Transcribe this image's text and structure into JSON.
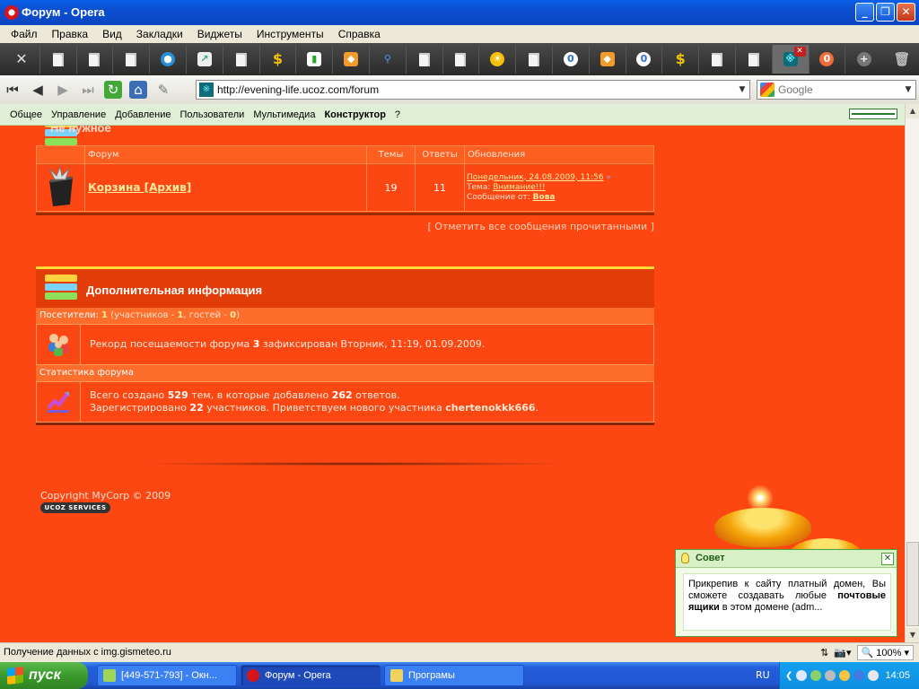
{
  "window": {
    "title": "Форум - Opera"
  },
  "menu": [
    "Файл",
    "Правка",
    "Вид",
    "Закладки",
    "Виджеты",
    "Инструменты",
    "Справка"
  ],
  "address": {
    "url": "http://evening-life.ucoz.com/forum"
  },
  "search": {
    "placeholder": "Google"
  },
  "admin_bar": [
    "Общее",
    "Управление",
    "Добавление",
    "Пользователи",
    "Мультимедиа",
    "Конструктор",
    "?"
  ],
  "forum": {
    "category_title": "Не нужное",
    "headers": {
      "forum": "Форум",
      "topics": "Темы",
      "replies": "Ответы",
      "updates": "Обновления"
    },
    "row": {
      "name": "Корзина [Архив]",
      "topics": "19",
      "replies": "11",
      "last_date": "Понедельник, 24.08.2009, 11:56",
      "topic_label": "Тема:",
      "topic": "Внимание!!!",
      "author_label": "Сообщение от:",
      "author": "Вова"
    },
    "mark_read": "Отметить все сообщения прочитанными"
  },
  "info": {
    "title": "Дополнительная информация",
    "visitors_label": "Посетители:",
    "visitors_total": "1",
    "members_label": "(участников -",
    "members": "1",
    "guests_label": ", гостей -",
    "guests": "0",
    "close_paren": ")",
    "record_text_1": "Рекорд посещаемости форума",
    "record_num": "3",
    "record_text_2": "зафиксирован Вторник, 11:19, 01.09.2009.",
    "stats_title": "Статистика форума",
    "stats_line1_a": "Всего создано",
    "stats_topics": "529",
    "stats_line1_b": "тем, в которые добавлено",
    "stats_replies": "262",
    "stats_line1_c": "ответов.",
    "stats_line2_a": "Зарегистрировано",
    "stats_members": "22",
    "stats_line2_b": "участников. Приветствуем нового участника",
    "stats_new_member": "chertenokkk666",
    "stats_line2_c": "."
  },
  "footer": {
    "copyright": "Copyright MyCorp © 2009",
    "badge": "UCOZ SERVICES"
  },
  "tip": {
    "title": "Совет",
    "text_1": "Прикрепив к сайту платный домен, Вы сможете создавать любые",
    "text_bold": "почтовые ящики",
    "text_2": "в этом домене (adm..."
  },
  "status": {
    "text": "Получение данных с img.gismeteo.ru",
    "zoom": "100%"
  },
  "taskbar": {
    "start": "пуск",
    "tasks": [
      "[449-571-793] - Окн...",
      "Форум - Opera",
      "Програмы"
    ],
    "lang": "RU",
    "clock": "14:05"
  }
}
